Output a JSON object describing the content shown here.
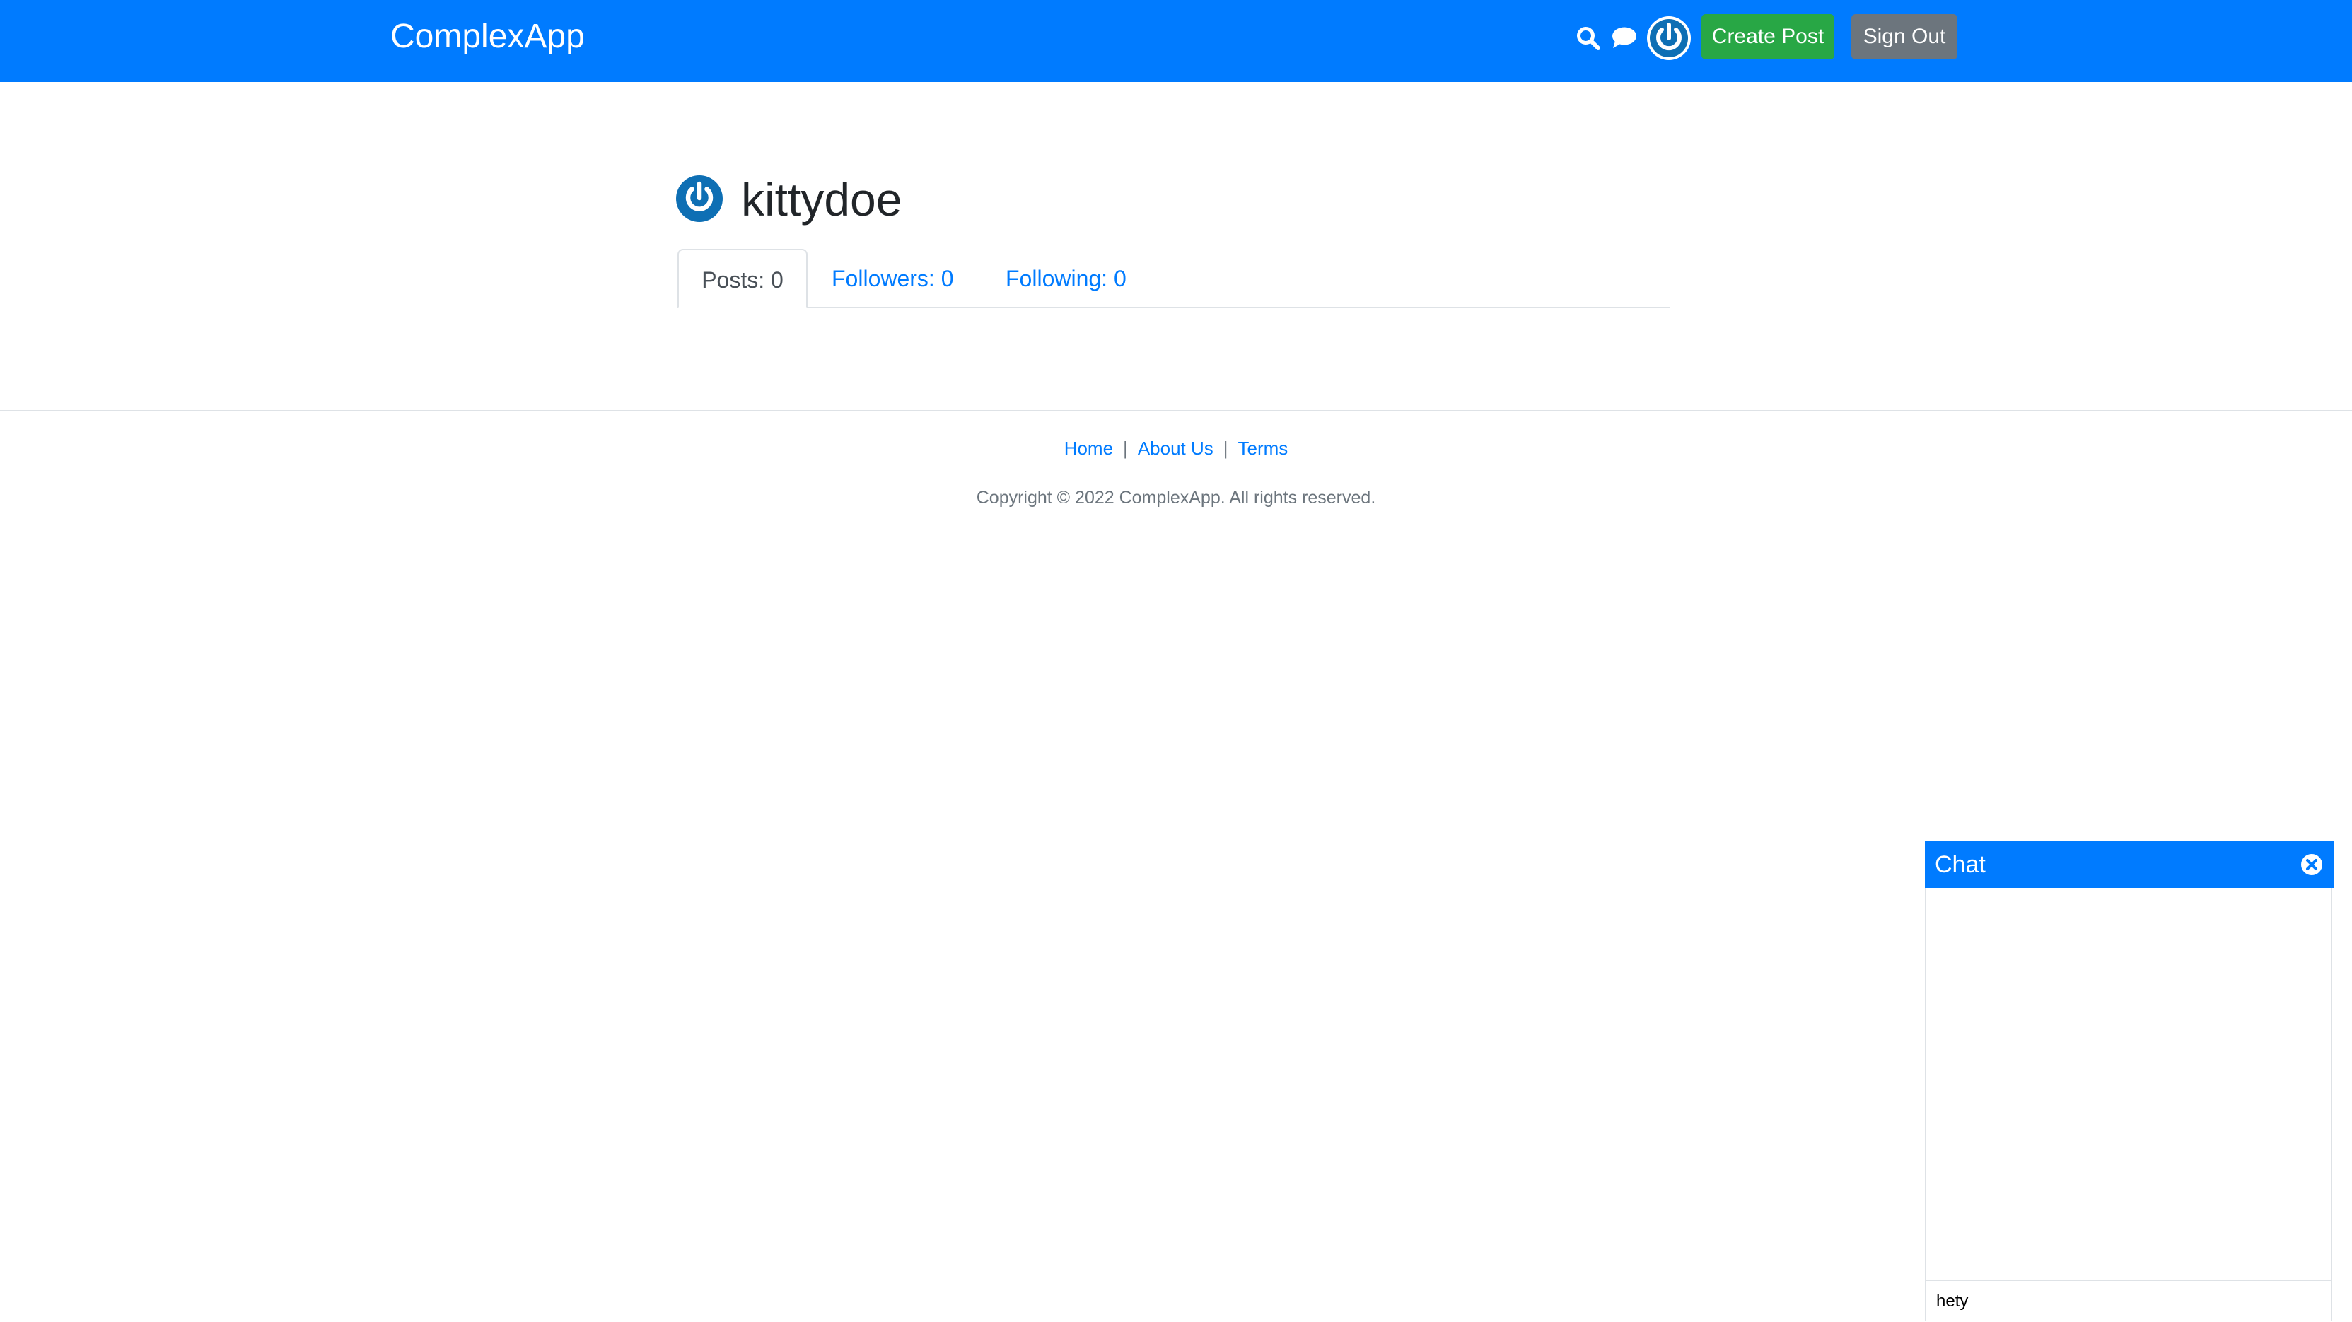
{
  "header": {
    "brand": "ComplexApp",
    "create_post_label": "Create Post",
    "sign_out_label": "Sign Out",
    "icons": [
      "search-icon",
      "chat-icon",
      "avatar"
    ]
  },
  "profile": {
    "username": "kittydoe",
    "tabs": [
      {
        "label": "Posts: 0",
        "active": true
      },
      {
        "label": "Followers: 0",
        "active": false
      },
      {
        "label": "Following: 0",
        "active": false
      }
    ]
  },
  "footer": {
    "links": [
      "Home",
      "About Us",
      "Terms"
    ],
    "separator": "|",
    "copyright": "Copyright © 2022 ComplexApp. All rights reserved."
  },
  "chat": {
    "title": "Chat",
    "input_value": "hety"
  },
  "colors": {
    "primary": "#007bff",
    "success": "#28a745",
    "secondary": "#6c757d",
    "avatar": "#0e6fb4",
    "border": "#dee2e6"
  }
}
